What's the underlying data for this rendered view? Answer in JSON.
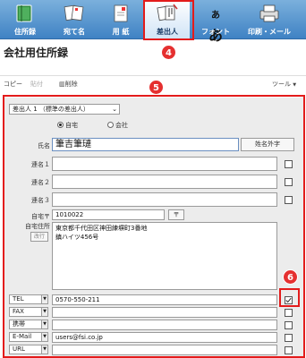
{
  "toolbar": {
    "items": [
      {
        "label": "住所録",
        "icon": "address-book-icon"
      },
      {
        "label": "宛て名",
        "icon": "recipient-icon"
      },
      {
        "label": "用 紙",
        "icon": "paper-icon"
      },
      {
        "label": "差出人",
        "icon": "sender-icon"
      },
      {
        "label": "フォント",
        "icon": "font-icon"
      },
      {
        "label": "印刷・メール",
        "icon": "printer-icon"
      }
    ]
  },
  "callouts": {
    "sender_tab": "4",
    "panel": "5",
    "checkbox": "6"
  },
  "title": "会社用住所録",
  "subbar": {
    "copy": "コピー",
    "paste": "貼付",
    "delete": "削除",
    "tools": "ツール"
  },
  "sender": {
    "select_value": "差出人 1 （標準の差出人）",
    "radio_home": "自宅",
    "radio_company": "会社"
  },
  "form": {
    "name_label": "氏名",
    "name_value": "筆吉筆璉",
    "external_chars_button": "姓名外字",
    "joint_labels": [
      "連名１",
      "連名２",
      "連名３"
    ],
    "postal_label": "自宅〒",
    "postal_value": "1010022",
    "postal_button": "〒",
    "address_label": "自宅住所",
    "address_button": "改行",
    "address_lines": [
      "東京都千代田区神田練塀町3番地",
      "鎮ハイツ456号"
    ]
  },
  "contacts": [
    {
      "type": "TEL",
      "value": "0570-550-211",
      "checked": true
    },
    {
      "type": "FAX",
      "value": "",
      "checked": false
    },
    {
      "type": "携帯",
      "value": "",
      "checked": false
    },
    {
      "type": "E-Mail",
      "value": "users@fsi.co.jp",
      "checked": false
    },
    {
      "type": "URL",
      "value": "",
      "checked": false
    }
  ],
  "colors": {
    "accent_red": "#e31b1b",
    "toolbar_blue": "#3f82c4"
  }
}
